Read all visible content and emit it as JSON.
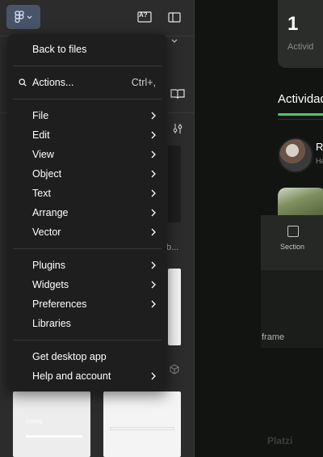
{
  "menu": {
    "back": "Back to files",
    "actions": {
      "label": "Actions...",
      "shortcut": "Ctrl+,"
    },
    "groups": [
      [
        "File",
        "Edit",
        "View",
        "Object",
        "Text",
        "Arrange",
        "Vector"
      ],
      [
        "Plugins",
        "Widgets",
        "Preferences",
        "Libraries"
      ]
    ],
    "bottom": [
      "Get desktop app",
      "Help and account"
    ]
  },
  "toolbar": {
    "ai_icon_text": "A?"
  },
  "left_panel": {
    "fragment_text": "b..."
  },
  "canvas": {
    "card_number": "1",
    "card_sub": "Activid",
    "tab_label": "Actividad",
    "avatar_letter": "R",
    "avatar_sub": "Ha",
    "section_label": "Section",
    "frame_label": "frame",
    "thumb_text": "Listing",
    "watermark": "Platzi"
  },
  "colors": {
    "accent_green": "#47c96b",
    "menu_bg": "#1e1e1e",
    "logo_bg": "#4a5468"
  }
}
